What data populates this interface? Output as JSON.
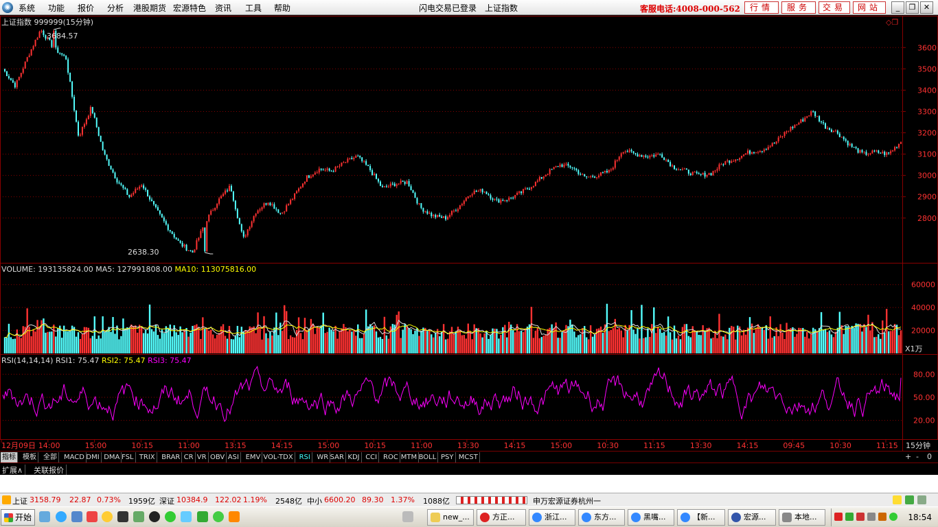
{
  "menubar": {
    "items": [
      "系统",
      "功能",
      "报价",
      "分析",
      "港股期货",
      "宏源特色",
      "资讯",
      "工具",
      "帮助"
    ],
    "login_status": "闪电交易已登录",
    "current_security": "上证指数",
    "hotline": "客服电话:4008-000-562",
    "buttons": [
      "行情",
      "服务",
      "交易",
      "网站"
    ]
  },
  "chart_data": [
    {
      "type": "line",
      "title": "上证指数 999999(15分钟)",
      "ylim": [
        2638.3,
        3684.57
      ],
      "y_ticks": [
        "3600",
        "3500",
        "3400",
        "3300",
        "3200",
        "3100",
        "3000",
        "2900",
        "2800"
      ],
      "high_label": "3684.57",
      "low_label": "2638.30",
      "x_ticks": [
        "12月09日",
        "14:00",
        "15:00",
        "10:15",
        "11:00",
        "13:15",
        "14:15",
        "15:00",
        "10:15",
        "11:00",
        "13:30",
        "14:15",
        "15:00",
        "10:30",
        "11:15",
        "13:30",
        "14:15",
        "09:45",
        "10:30",
        "11:15"
      ],
      "period_label": "15分钟",
      "anchors": [
        [
          0,
          3500
        ],
        [
          2,
          3420
        ],
        [
          3,
          3560
        ],
        [
          4,
          3684.57
        ],
        [
          5,
          3600
        ],
        [
          6,
          3550
        ],
        [
          7,
          3180
        ],
        [
          8,
          3320
        ],
        [
          9,
          3100
        ],
        [
          10,
          2980
        ],
        [
          11,
          2900
        ],
        [
          12,
          2960
        ],
        [
          13,
          2850
        ],
        [
          14,
          2760
        ],
        [
          15,
          2680
        ],
        [
          16,
          2638.3
        ],
        [
          17,
          2780
        ],
        [
          18,
          2880
        ],
        [
          19,
          2950
        ],
        [
          20,
          2700
        ],
        [
          21,
          2830
        ],
        [
          22,
          2880
        ],
        [
          23,
          2820
        ],
        [
          24,
          2900
        ],
        [
          25,
          2990
        ],
        [
          26,
          3030
        ],
        [
          27,
          3020
        ],
        [
          28,
          3060
        ],
        [
          29,
          3090
        ],
        [
          30,
          3030
        ],
        [
          31,
          2940
        ],
        [
          32,
          2960
        ],
        [
          33,
          2970
        ],
        [
          34,
          2850
        ],
        [
          35,
          2810
        ],
        [
          36,
          2800
        ],
        [
          37,
          2850
        ],
        [
          38,
          2920
        ],
        [
          39,
          2930
        ],
        [
          40,
          2880
        ],
        [
          41,
          2890
        ],
        [
          42,
          2920
        ],
        [
          43,
          2960
        ],
        [
          44,
          3010
        ],
        [
          45,
          3050
        ],
        [
          46,
          3040
        ],
        [
          47,
          2990
        ],
        [
          48,
          3000
        ],
        [
          49,
          3020
        ],
        [
          50,
          3120
        ],
        [
          51,
          3100
        ],
        [
          52,
          3090
        ],
        [
          53,
          3100
        ],
        [
          54,
          3040
        ],
        [
          55,
          3020
        ],
        [
          56,
          3000
        ],
        [
          57,
          3010
        ],
        [
          58,
          3060
        ],
        [
          59,
          3080
        ],
        [
          60,
          3110
        ],
        [
          61,
          3120
        ],
        [
          62,
          3150
        ],
        [
          63,
          3210
        ],
        [
          64,
          3250
        ],
        [
          65,
          3300
        ],
        [
          66,
          3230
        ],
        [
          67,
          3200
        ],
        [
          68,
          3140
        ],
        [
          69,
          3100
        ],
        [
          70,
          3110
        ],
        [
          71,
          3100
        ],
        [
          72,
          3158.79
        ]
      ]
    },
    {
      "type": "bar",
      "title_prefix": "VOLUME:",
      "volume": "193135824.00",
      "ma5_label": "MA5:",
      "ma5": "127991808.00",
      "ma10_label": "MA10:",
      "ma10": "113075816.00",
      "ylim": [
        0,
        70000
      ],
      "y_ticks": [
        "60000",
        "40000",
        "20000"
      ],
      "unit": "X1万"
    },
    {
      "type": "line",
      "title": "RSI(14,14,14)",
      "rsi1_label": "RSI1:",
      "rsi1": "75.47",
      "rsi2_label": "RSI2:",
      "rsi2": "75.47",
      "rsi3_label": "RSI3:",
      "rsi3": "75.47",
      "ylim": [
        0,
        100
      ],
      "y_ticks": [
        "80.00",
        "50.00",
        "20.00"
      ]
    }
  ],
  "tabs": [
    "指标",
    "模板",
    "全部",
    "MACD",
    "DMI",
    "DMA",
    "FSL",
    "TRIX",
    "BRAR",
    "CR",
    "VR",
    "OBV",
    "ASI",
    "EMV",
    "VOL-TDX",
    "RSI",
    "WR",
    "SAR",
    "KDJ",
    "CCI",
    "ROC",
    "MTM",
    "BOLL",
    "PSY",
    "MCST"
  ],
  "active_tab": "RSI",
  "zoom_controls": [
    "+",
    "-",
    "0"
  ],
  "ext_tabs": [
    "扩展∧",
    "关联报价"
  ],
  "status": {
    "sh_label": "上证",
    "sh_value": "3158.79",
    "sh_change": "22.87",
    "sh_pct": "0.73%",
    "sh_amount": "1959亿",
    "sz_label": "深证",
    "sz_value": "10384.9",
    "sz_change": "122.02",
    "sz_pct": "1.19%",
    "sz_amount": "2548亿",
    "zx_label": "中小",
    "zx_value": "6600.20",
    "zx_change": "89.30",
    "zx_pct": "1.37%",
    "zx_amount": "1088亿",
    "broker": "申万宏源证券杭州一"
  },
  "taskbar": {
    "start_label": "开始",
    "tasks": [
      "new_...",
      "方正...",
      "浙江...",
      "东方...",
      "黑嘴...",
      "【新...",
      "宏源...",
      "本地..."
    ],
    "clock": "18:54"
  },
  "colors": {
    "up": "#ff3232",
    "down": "#54ffff",
    "ma": "#ffff00",
    "rsi": "#ff00ff",
    "grid": "#8a0000"
  }
}
